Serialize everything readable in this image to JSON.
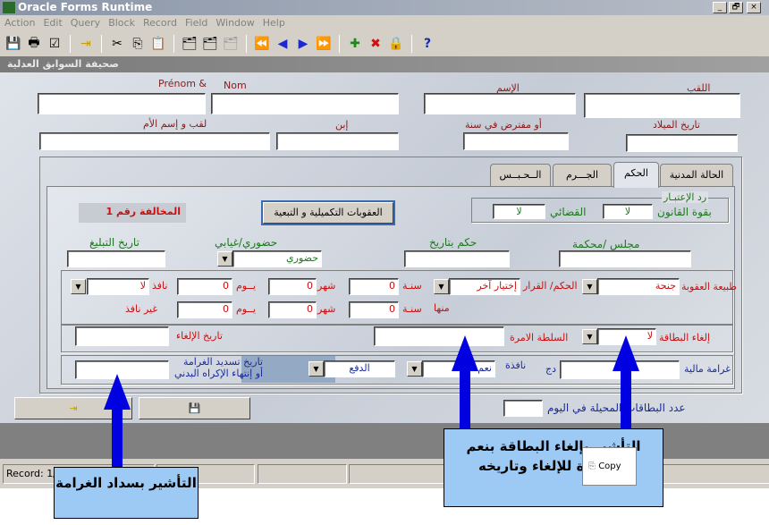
{
  "window": {
    "title": "Oracle Forms Runtime",
    "controls": [
      "_",
      "🗗",
      "×"
    ]
  },
  "menu": [
    "Action",
    "Edit",
    "Query",
    "Block",
    "Record",
    "Field",
    "Window",
    "Help"
  ],
  "toolbar": {
    "help": "?"
  },
  "form": {
    "title": "صحيفة السوابق العدلية",
    "labels": {
      "prenom": "Prénom &",
      "nom": "Nom",
      "ism": "الإسم",
      "laqab": "اللقب",
      "mother": "لقب و إسم الأم",
      "ibn": "إبن",
      "presumed": "أو مفترض في سنة",
      "dob": "تاريخ الميلاد"
    }
  },
  "tabs": [
    {
      "label": "الحالة المدنية"
    },
    {
      "label": "الحكم",
      "active": true
    },
    {
      "label": "الجـــرم"
    },
    {
      "label": "الــحـبــس"
    }
  ],
  "judgment": {
    "rehab_title": "رد الإعتبـار",
    "by_law": "بقوة القانون",
    "by_law_value": "لا",
    "judicial": "القضائي",
    "judicial_value": "لا",
    "penalties_button": "العقوبات التكميلية و التبعية",
    "offense": "المخالفة رقم 1",
    "notify_date": "تاريخ التبليغ",
    "presence": "حضوري/غيابي",
    "presence_value": "حضوري",
    "judgment_date": "حكم بتاريخ",
    "court": "مجلس /محكمة",
    "penalty_type": "طبيعة العقوبة",
    "penalty_type_value": "جنحة",
    "decision": "الحكم/ القرار",
    "decision_value": "إختيار آخر",
    "year": "سنـة",
    "month": "شهر",
    "day": "يــوم",
    "effective": "نافذ",
    "effective_value": "لا",
    "of_which": "منها",
    "not_effective": "غير نافذ",
    "year1": "0",
    "month1": "0",
    "day1": "0",
    "year2": "0",
    "month2": "0",
    "day2": "0",
    "cancel_card": "إلغاء البطاقة",
    "cancel_card_value": "لا",
    "authority": "السلطة الامرة",
    "cancel_date": "تاريخ الإلغاء",
    "fine": "غرامة مالية",
    "currency": "دج",
    "fine_effective": "نافذة",
    "fine_effective_value": "نعم",
    "payment_value": "الدفع",
    "payment_date_l1": "تاريخ تسديد الغرامة",
    "payment_date_l2": "أو إنتهاء الإكراه البدني",
    "cards_per_day": "عدد البطاقات المحيلة في اليوم"
  },
  "status": {
    "record": "Record: 1/"
  },
  "callouts": {
    "left": "التأشير بسداد الغرامة",
    "right": "التأشير بإلغاء البطاقة بنعم المحررة للإلغاء وتاريخه"
  },
  "popup": {
    "copy": "Copy"
  }
}
